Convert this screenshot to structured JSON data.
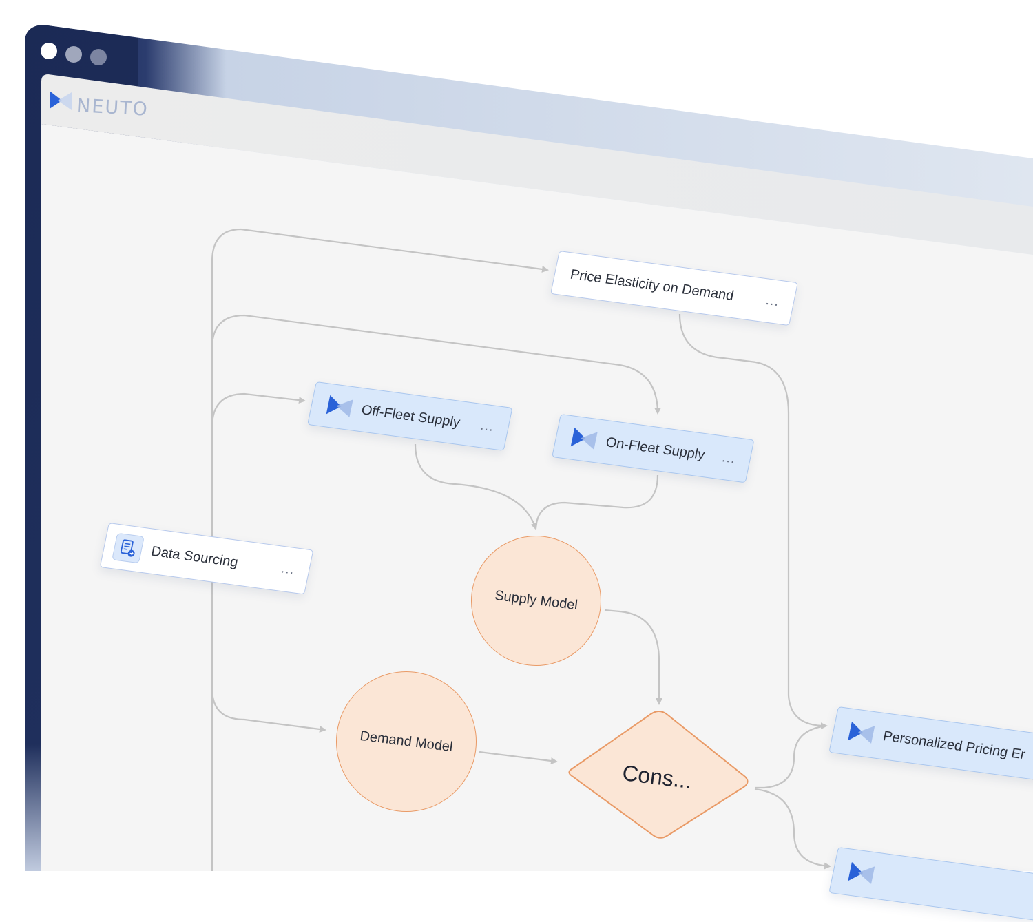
{
  "app": {
    "logo_text": "NEUTO"
  },
  "window": {
    "controls": [
      "close-dot",
      "minimize-dot",
      "maximize-dot"
    ]
  },
  "nodes": {
    "price_elasticity": {
      "label": "Price Elasticity on Demand",
      "more": "..."
    },
    "off_fleet": {
      "label": "Off-Fleet Supply",
      "more": "..."
    },
    "on_fleet": {
      "label": "On-Fleet Supply",
      "more": "..."
    },
    "data_sourcing": {
      "label": "Data Sourcing",
      "more": "..."
    },
    "supply_model": {
      "label": "Supply Model"
    },
    "demand_model": {
      "label": "Demand Model"
    },
    "cons": {
      "label": "Cons..."
    },
    "personalized_pricing": {
      "label": "Personalized Pricing Er"
    }
  },
  "colors": {
    "frame_dark": "#1b2a55",
    "canvas_bg": "#f5f5f5",
    "node_blue_bg": "#d9e8fb",
    "node_orange_bg": "#fbe6d6",
    "node_orange_border": "#e99a66",
    "connector": "#c4c4c4",
    "brand_blue": "#2a62d8"
  }
}
